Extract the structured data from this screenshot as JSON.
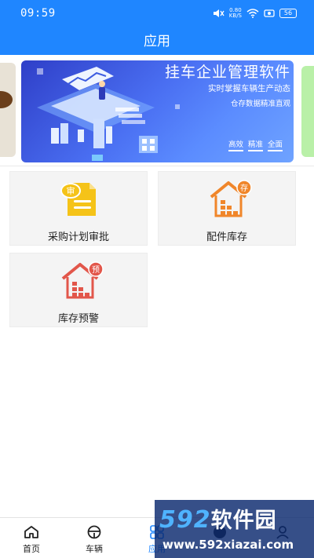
{
  "status_bar": {
    "time": "09:59",
    "net_speed_value": "0.80",
    "net_speed_unit": "KB/S",
    "battery": "56"
  },
  "header": {
    "title": "应用"
  },
  "banner": {
    "title": "挂车企业管理软件",
    "subtitle_1": "实时掌握车辆生产动态",
    "subtitle_2": "仓存数据精准直观",
    "tags": [
      "高效",
      "精准",
      "全面"
    ]
  },
  "tiles": [
    {
      "label": "采购计划审批",
      "badge": "审",
      "color": "#f5c318"
    },
    {
      "label": "配件库存",
      "badge": "存",
      "color": "#f0862a"
    },
    {
      "label": "库存预警",
      "badge": "预",
      "color": "#e2564a"
    }
  ],
  "tabbar": {
    "items": [
      {
        "label": "首页",
        "icon": "home-icon"
      },
      {
        "label": "车辆",
        "icon": "steering-wheel-icon"
      },
      {
        "label": "应用",
        "icon": "apps-grid-icon",
        "active": true
      },
      {
        "label": "",
        "icon": "chat-icon"
      },
      {
        "label": "",
        "icon": "user-icon"
      }
    ]
  },
  "watermark": {
    "brand_number": "592",
    "brand_text": "软件园",
    "url": "www.592xiazai.com"
  },
  "colors": {
    "primary": "#1f86ff",
    "tile_bg": "#f4f4f4"
  }
}
